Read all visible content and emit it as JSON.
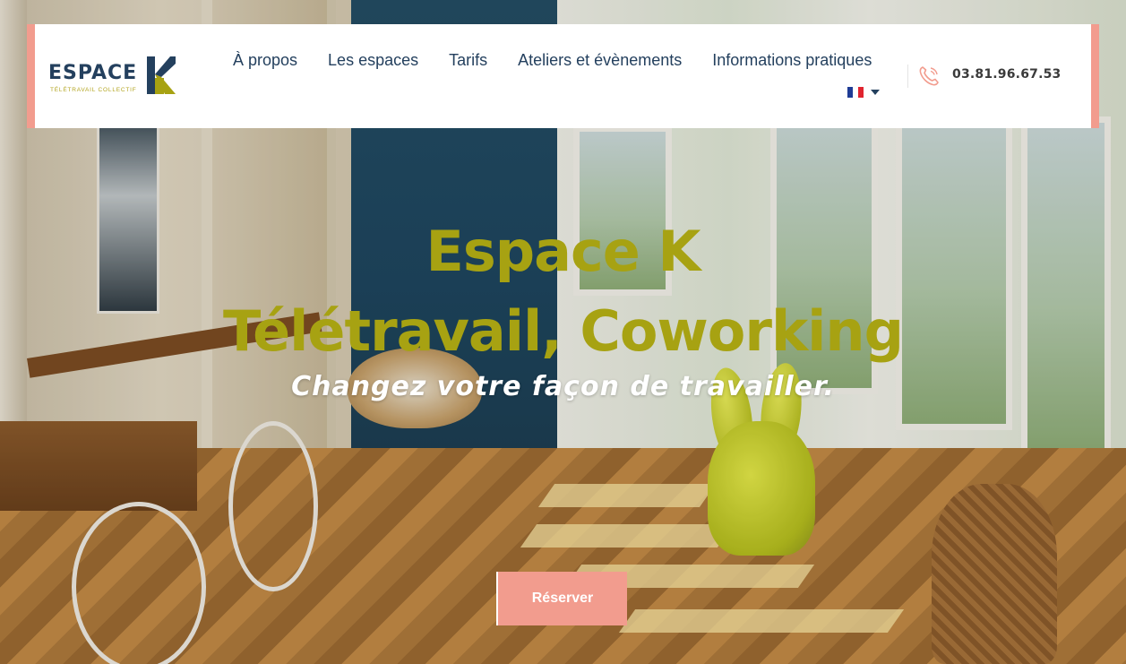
{
  "brand": {
    "logo_word": "ESPACE",
    "logo_letter": "K",
    "logo_tagline": "TÉLÉTRAVAIL COLLECTIF",
    "colors": {
      "navy": "#24405e",
      "olive": "#a7a212",
      "coral": "#f29c8e"
    }
  },
  "nav": {
    "items": [
      {
        "label": "À propos"
      },
      {
        "label": "Les espaces"
      },
      {
        "label": "Tarifs"
      },
      {
        "label": "Ateliers et évènements"
      },
      {
        "label": "Informations pratiques"
      }
    ],
    "language": {
      "icon": "french-flag-icon",
      "caret_icon": "caret-down-icon"
    }
  },
  "contact": {
    "phone_icon": "phone-icon",
    "phone": "03.81.96.67.53"
  },
  "hero": {
    "title_line1": "Espace K",
    "title_line2": "Télétravail, Coworking",
    "subtitle": "Changez votre façon de travailler.",
    "cta_label": "Réserver"
  }
}
